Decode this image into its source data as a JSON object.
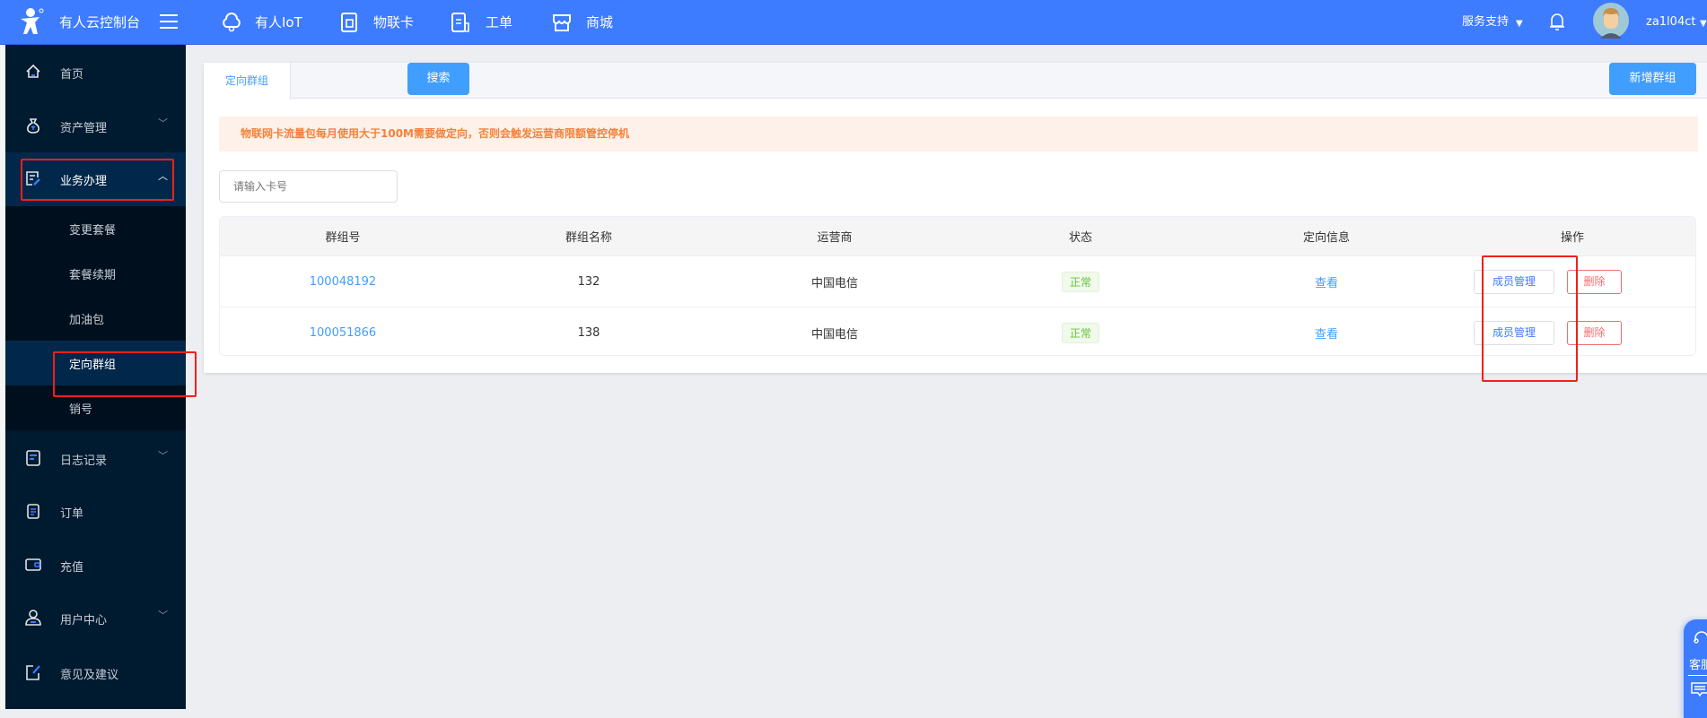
{
  "header": {
    "app_title": "有人云控制台",
    "nav": [
      {
        "label": "有人IoT",
        "icon": "cloud-icon"
      },
      {
        "label": "物联卡",
        "icon": "sim-card-icon"
      },
      {
        "label": "工单",
        "icon": "ticket-icon"
      },
      {
        "label": "商城",
        "icon": "shop-icon"
      }
    ],
    "support": "服务支持",
    "username": "za1l04ct"
  },
  "sidebar": {
    "items": [
      {
        "label": "首页"
      },
      {
        "label": "资产管理"
      },
      {
        "label": "业务办理"
      },
      {
        "label": "日志记录"
      },
      {
        "label": "订单"
      },
      {
        "label": "充值"
      },
      {
        "label": "用户中心"
      },
      {
        "label": "意见及建议"
      }
    ],
    "sub_items": [
      {
        "label": "变更套餐"
      },
      {
        "label": "套餐续期"
      },
      {
        "label": "加油包"
      },
      {
        "label": "定向群组"
      },
      {
        "label": "销号"
      }
    ]
  },
  "main": {
    "tab": "定向群组",
    "alert": "物联网卡流量包每月使用大于100M需要做定向，否则会触发运营商限额管控停机",
    "search_placeholder": "请输入卡号",
    "search_button": "搜索",
    "add_button": "新增群组",
    "table": {
      "columns": [
        "群组号",
        "群组名称",
        "运营商",
        "状态",
        "定向信息",
        "操作"
      ],
      "rows": [
        {
          "id": "100048192",
          "name": "132",
          "carrier": "中国电信",
          "status": "正常",
          "info": "查看",
          "manage": "成员管理",
          "delete": "删除"
        },
        {
          "id": "100051866",
          "name": "138",
          "carrier": "中国电信",
          "status": "正常",
          "info": "查看",
          "manage": "成员管理",
          "delete": "删除"
        }
      ]
    }
  },
  "chat": {
    "label": "客服"
  },
  "colors": {
    "header": "#3d7bff",
    "sidebar": "#001a2f",
    "accent": "#409eff",
    "warning": "#f5813a",
    "danger": "#f56c6c",
    "highlight": "#f0201a"
  }
}
